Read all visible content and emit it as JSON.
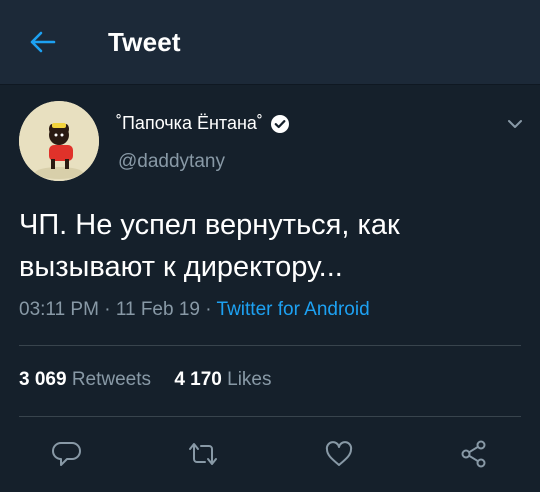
{
  "header": {
    "title": "Tweet"
  },
  "tweet": {
    "display_name": "˚Папочка Ёнтана˚",
    "handle": "@daddytany",
    "text": "ЧП. Не успел вернуться, как\nвызывают к директору...",
    "time": "03:11 PM",
    "date": "11 Feb 19",
    "source": "Twitter for Android",
    "separator": "·"
  },
  "stats": {
    "retweets_count": "3 069",
    "retweets_label": "Retweets",
    "likes_count": "4 170",
    "likes_label": "Likes"
  },
  "icons": {
    "back": "arrow-left-icon",
    "verified": "verified-badge-icon",
    "more": "chevron-down-icon",
    "reply": "reply-icon",
    "retweet": "retweet-icon",
    "like": "heart-icon",
    "share": "share-icon"
  },
  "colors": {
    "background": "#15202b",
    "header": "#1c2938",
    "accent": "#1da1f2",
    "secondary_text": "#8899a6",
    "divider": "#38444d"
  }
}
